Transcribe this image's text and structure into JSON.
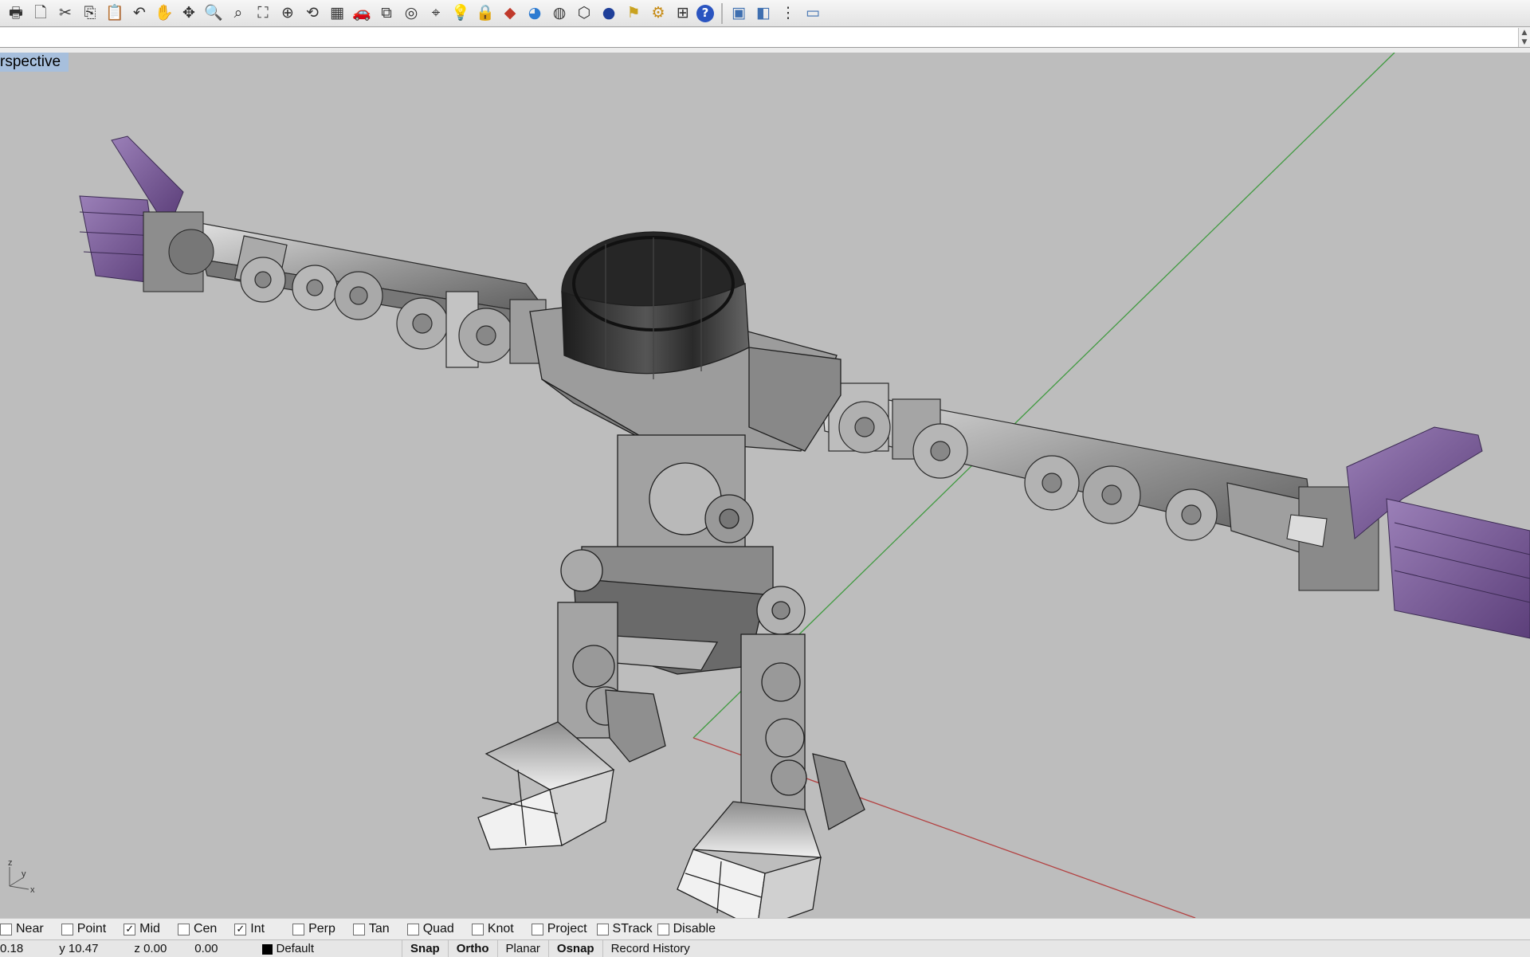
{
  "toolbar": {
    "icons": [
      "print-icon",
      "new-icon",
      "cut-icon",
      "copy-icon",
      "paste-icon",
      "undo-icon",
      "pan-icon",
      "move-icon",
      "zoom-in-icon",
      "zoom-window-icon",
      "zoom-extents-icon",
      "zoom-selected-icon",
      "rotate-view-icon",
      "grid-icon",
      "car-icon",
      "properties-icon",
      "target-icon",
      "snap-icon",
      "light-icon",
      "lock-icon",
      "render-icon",
      "color-wheel-icon",
      "sphere-icon",
      "mesh-icon",
      "render-preview-icon",
      "flag-icon",
      "gears-icon",
      "analysis-icon",
      "help-icon",
      "box-icon",
      "box-icon-2",
      "options-icon",
      "window-icon"
    ]
  },
  "viewport": {
    "title": "rspective"
  },
  "axis_widget": {
    "z": "z",
    "y": "y",
    "x": "x"
  },
  "osnaps": [
    {
      "label": "Near",
      "checked": false
    },
    {
      "label": "Point",
      "checked": false
    },
    {
      "label": "Mid",
      "checked": true
    },
    {
      "label": "Cen",
      "checked": false
    },
    {
      "label": "Int",
      "checked": true
    },
    {
      "label": "Perp",
      "checked": false
    },
    {
      "label": "Tan",
      "checked": false
    },
    {
      "label": "Quad",
      "checked": false
    },
    {
      "label": "Knot",
      "checked": false
    },
    {
      "label": "Project",
      "checked": false
    },
    {
      "label": "STrack",
      "checked": false
    },
    {
      "label": "Disable",
      "checked": false
    }
  ],
  "status": {
    "x": "0.18",
    "y": "y 10.47",
    "z": "z 0.00",
    "dist": "0.00",
    "layer": "Default",
    "snap": "Snap",
    "ortho": "Ortho",
    "planar": "Planar",
    "osnap": "Osnap",
    "record_history": "Record History"
  },
  "colors": {
    "viewport_bg": "#bdbdbd",
    "title_bg": "#a7bfdc",
    "x_axis": "#b34141",
    "y_axis": "#3f9a3f",
    "hand_purple": "#7a5c97"
  }
}
